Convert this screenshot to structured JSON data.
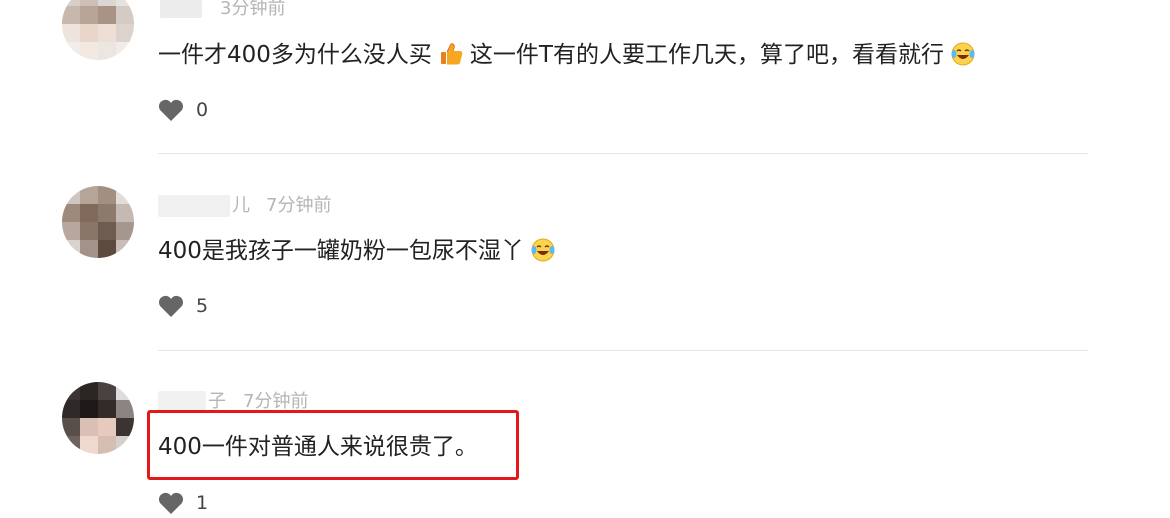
{
  "comments": [
    {
      "name_tail": "",
      "time": "3分钟前",
      "text_before": "一件才400多为什么没人买",
      "emoji1_name": "thumbs-up-icon",
      "text_middle": "这一件T有的人要工作几天，算了吧，看看就行",
      "emoji2_name": "laughing-crying-icon",
      "likes": "0"
    },
    {
      "name_tail": "儿",
      "time": "7分钟前",
      "text": "400是我孩子一罐奶粉一包尿不湿丫",
      "emoji_name": "laughing-crying-icon",
      "likes": "5"
    },
    {
      "name_tail": "子",
      "time": "7分钟前",
      "text": "400一件对普通人来说很贵了。",
      "likes": "1"
    }
  ],
  "colors": {
    "highlight_border": "#e0191d",
    "heart": "#666666",
    "meta_text": "#b5b5b5"
  }
}
